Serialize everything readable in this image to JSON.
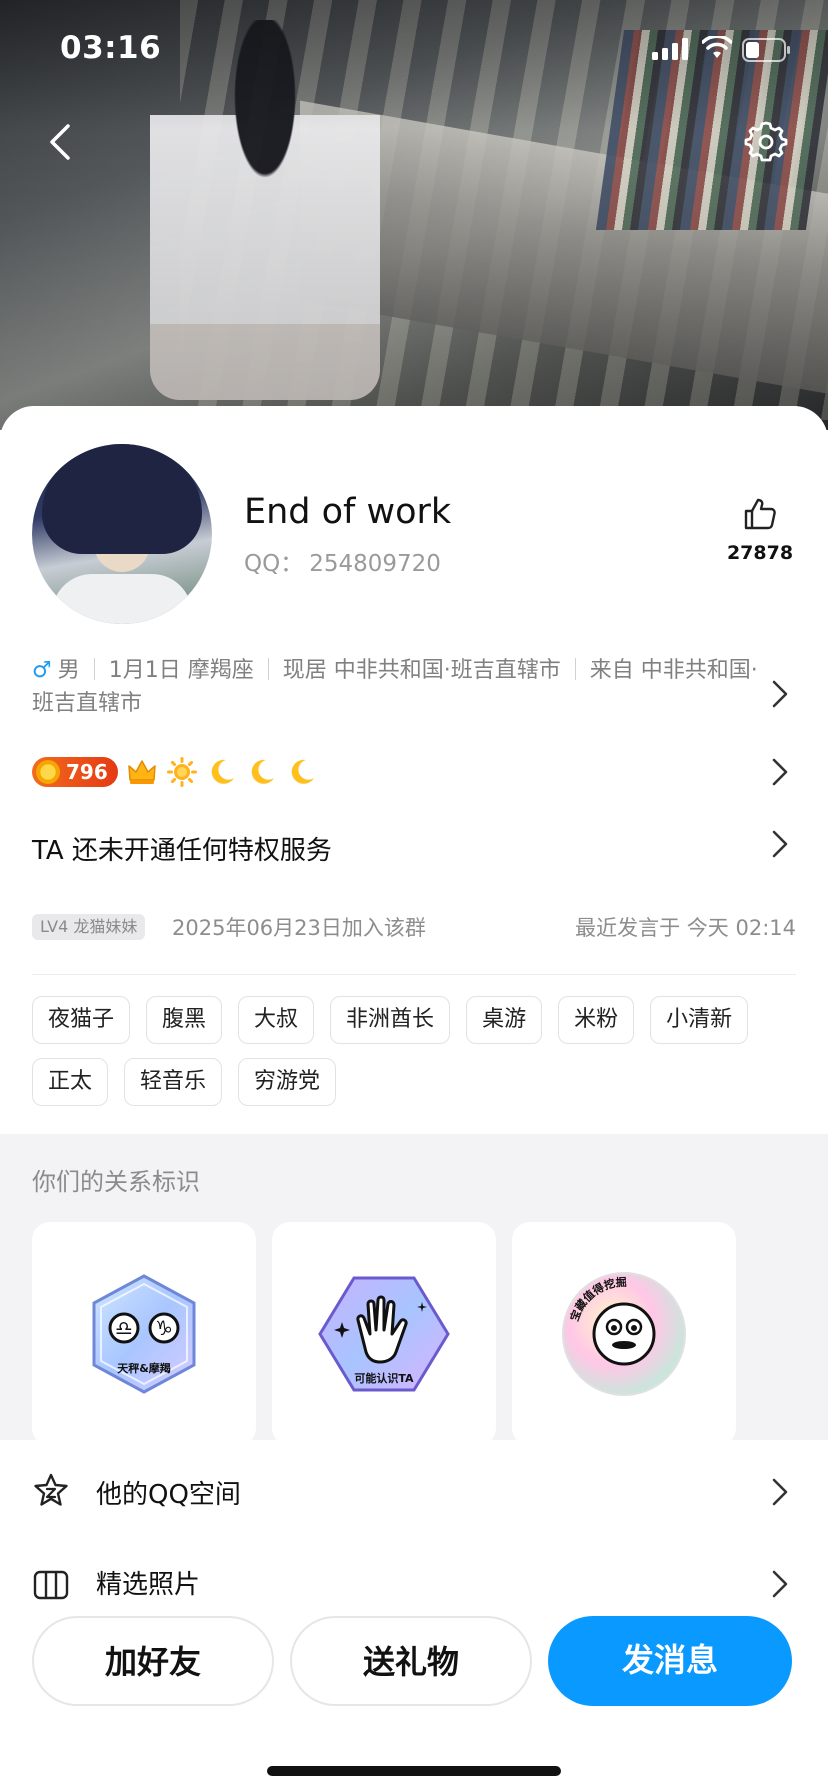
{
  "status_bar": {
    "time": "03:16",
    "icons": [
      "cellular-signal-icon",
      "wifi-icon",
      "battery-icon"
    ]
  },
  "header": {
    "nav_icons": [
      "back-icon",
      "settings-icon"
    ]
  },
  "profile": {
    "name": "End of work",
    "qq_label": "QQ：",
    "qq_number": "254809720",
    "likes": "27878",
    "gender_symbol": "♂",
    "gender": "男",
    "birthday": "1月1日 摩羯座",
    "residence": "现居 中非共和国·班吉直辖市",
    "hometown": "来自 中非共和国·班吉直辖市",
    "level_value": "796",
    "level_icons": [
      "crown-icon",
      "sun-icon",
      "moon-icon",
      "moon-icon",
      "moon-icon"
    ],
    "privilege_text": "TA 还未开通任何特权服务",
    "group_level": "LV4 龙猫妹妹",
    "join_date": "2025年06月23日加入该群",
    "last_post": "最近发言于 今天 02:14"
  },
  "tags": [
    "夜猫子",
    "腹黑",
    "大叔",
    "非洲酋长",
    "桌游",
    "米粉",
    "小清新",
    "正太",
    "轻音乐",
    "穷游党"
  ],
  "relation": {
    "title": "你们的关系标识",
    "badges": [
      {
        "name": "libra-capricorn-badge",
        "text": "天秤&摩羯"
      },
      {
        "name": "may-know-badge",
        "text": "可能认识TA"
      },
      {
        "name": "treasure-badge",
        "text": "宝藏值得挖掘"
      }
    ]
  },
  "menu": {
    "space": "他的QQ空间",
    "photos": "精选照片"
  },
  "actions": {
    "add_friend": "加好友",
    "send_gift": "送礼物",
    "send_message": "发消息"
  },
  "colors": {
    "primary": "#0a99ff",
    "male": "#1f9cf0",
    "level_badge": "#e43a14"
  }
}
